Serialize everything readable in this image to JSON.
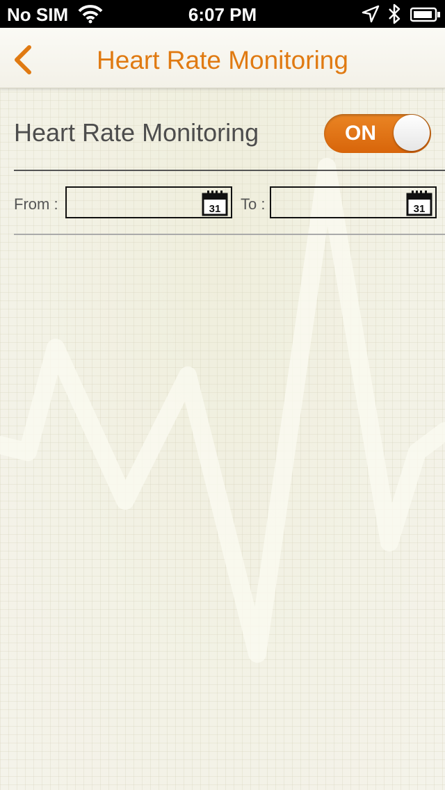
{
  "status_bar": {
    "carrier": "No SIM",
    "time": "6:07 PM"
  },
  "nav": {
    "title": "Heart Rate Monitoring",
    "back_icon": "chevron-left-icon"
  },
  "setting": {
    "label": "Heart Rate Monitoring",
    "toggle_state": "ON"
  },
  "date_range": {
    "from_label": "From :",
    "to_label": "To :",
    "from_value": "",
    "to_value": "",
    "calendar_day": "31"
  },
  "colors": {
    "accent": "#e07a12",
    "background": "#f1f0e3"
  }
}
